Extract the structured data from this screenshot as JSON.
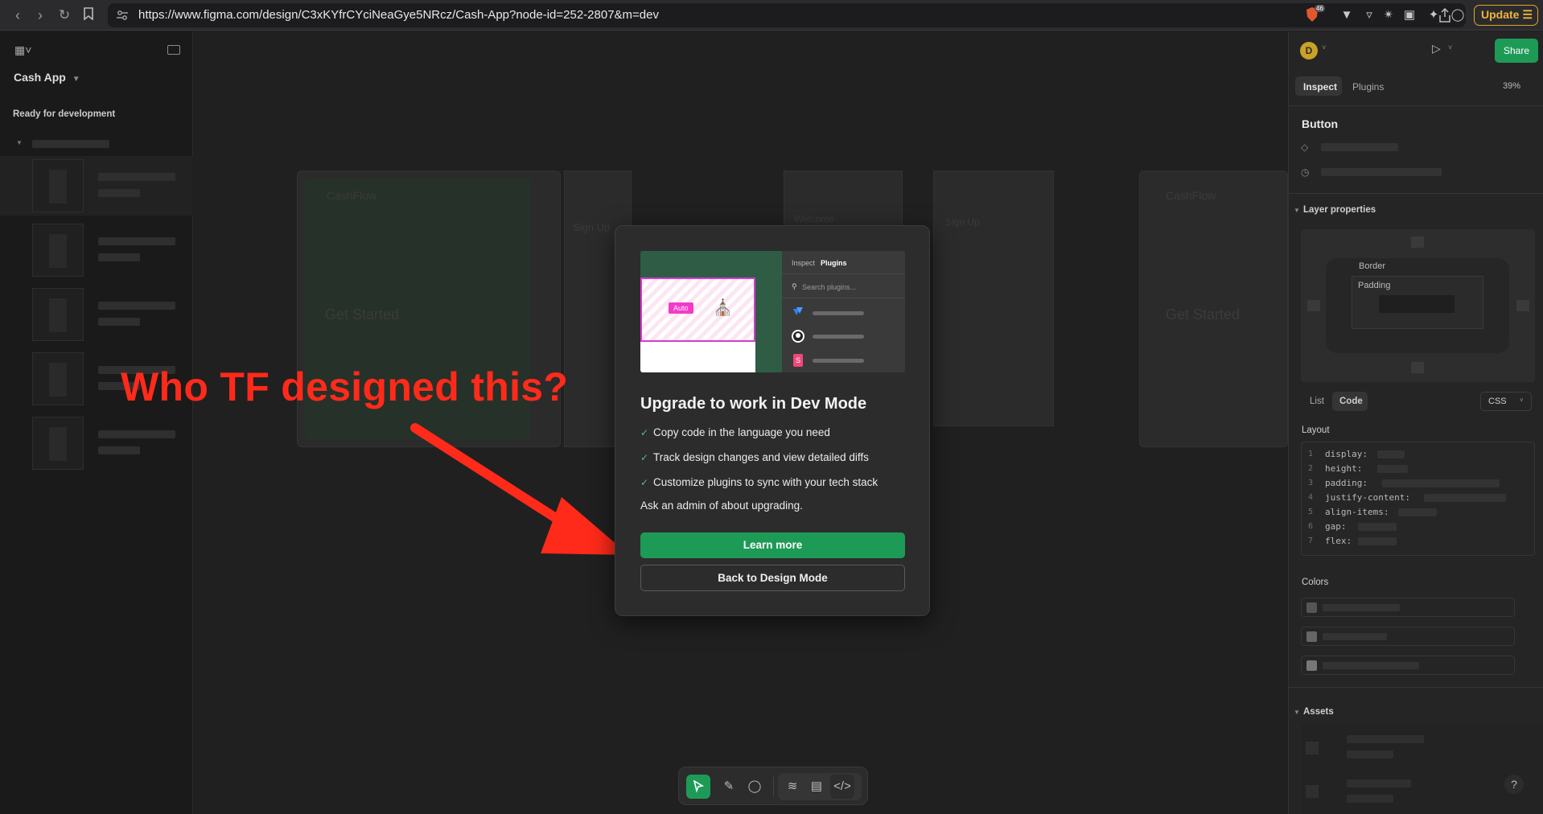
{
  "browser": {
    "url": "https://www.figma.com/design/C3xKYfrCYciNeaGye5NRcz/Cash-App?node-id=252-2807&m=dev",
    "badge_count": "46",
    "update_label": "Update"
  },
  "left_panel": {
    "file_name": "Cash App",
    "section_label": "Ready for development"
  },
  "canvas": {
    "frame_texts": [
      "CashFlow",
      "Get Started",
      "Sign Up",
      "Welcome",
      "Sign Up",
      "CashFlow",
      "Get Started"
    ]
  },
  "annotation": {
    "text": "Who TF designed this?"
  },
  "modal": {
    "illustration": {
      "tab_inspect": "Inspect",
      "tab_plugins": "Plugins",
      "search_placeholder": "Search plugins...",
      "auto_label": "Auto"
    },
    "title": "Upgrade to work in Dev Mode",
    "features": [
      "Copy code in the language you need",
      "Track design changes and view detailed diffs",
      "Customize plugins to sync with your tech stack"
    ],
    "note": "Ask an admin of about upgrading.",
    "learn_more": "Learn more",
    "back_button": "Back to Design Mode"
  },
  "right_panel": {
    "avatar_initial": "D",
    "share_label": "Share",
    "tabs": [
      "Inspect",
      "Plugins"
    ],
    "zoom": "39%",
    "component_name": "Button",
    "layer_properties_label": "Layer properties",
    "border_label": "Border",
    "padding_label": "Padding",
    "view_tabs": [
      "List",
      "Code"
    ],
    "language": "CSS",
    "layout_label": "Layout",
    "code_lines": [
      "display:",
      "height:",
      "padding:",
      "justify-content:",
      "align-items:",
      "gap:",
      "flex:"
    ],
    "colors_label": "Colors",
    "assets_label": "Assets",
    "help": "?"
  },
  "colors": {
    "accent_green": "#1e9a57",
    "annotation_red": "#ff2a1a",
    "update_gold": "#e0a52b"
  }
}
